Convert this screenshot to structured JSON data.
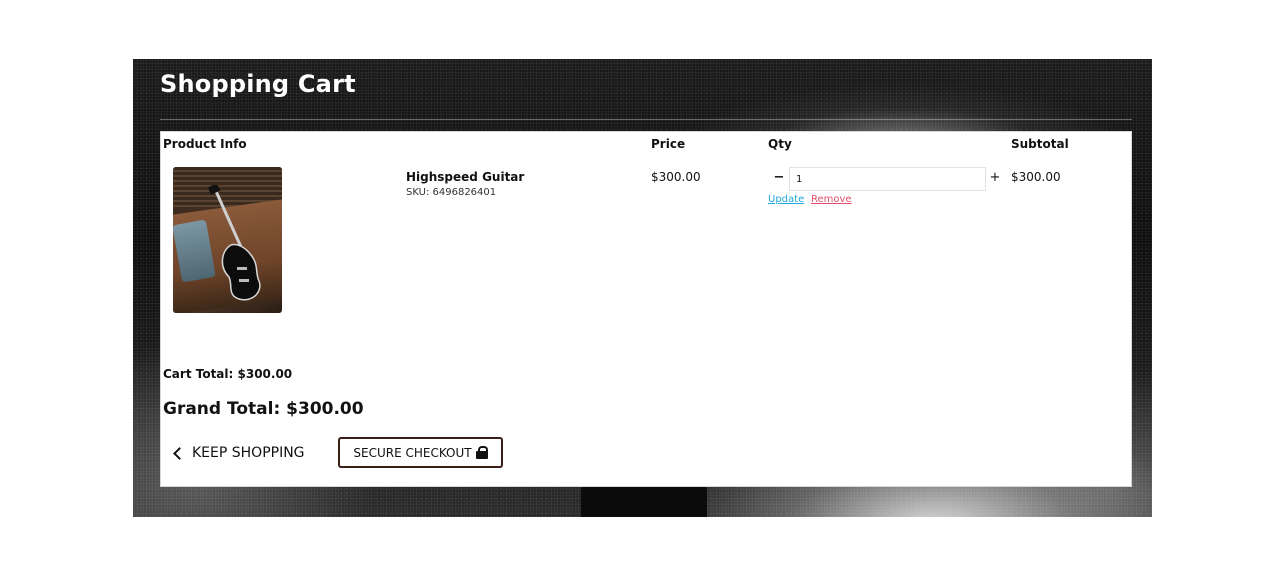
{
  "page": {
    "title": "Shopping Cart"
  },
  "table": {
    "headers": {
      "product_info": "Product Info",
      "price": "Price",
      "qty": "Qty",
      "subtotal": "Subtotal"
    },
    "items": [
      {
        "name": "Highspeed Guitar",
        "sku": "SKU: 6496826401",
        "price": "$300.00",
        "qty": "1",
        "subtotal": "$300.00",
        "image": "black-electric-guitar-on-leather-sofa",
        "qty_minus": "−",
        "qty_plus": "+",
        "update_label": "Update",
        "remove_label": "Remove"
      }
    ]
  },
  "totals": {
    "cart_total": "Cart Total: $300.00",
    "grand_total": "Grand Total: $300.00"
  },
  "actions": {
    "keep_shopping": "KEEP SHOPPING",
    "keep_shopping_icon": "chevron-left-icon",
    "checkout": "SECURE CHECKOUT",
    "checkout_icon": "lock-icon"
  },
  "colors": {
    "update_link": "#1fa8d9",
    "remove_link": "#e0506a",
    "checkout_border": "#3a1f17"
  }
}
